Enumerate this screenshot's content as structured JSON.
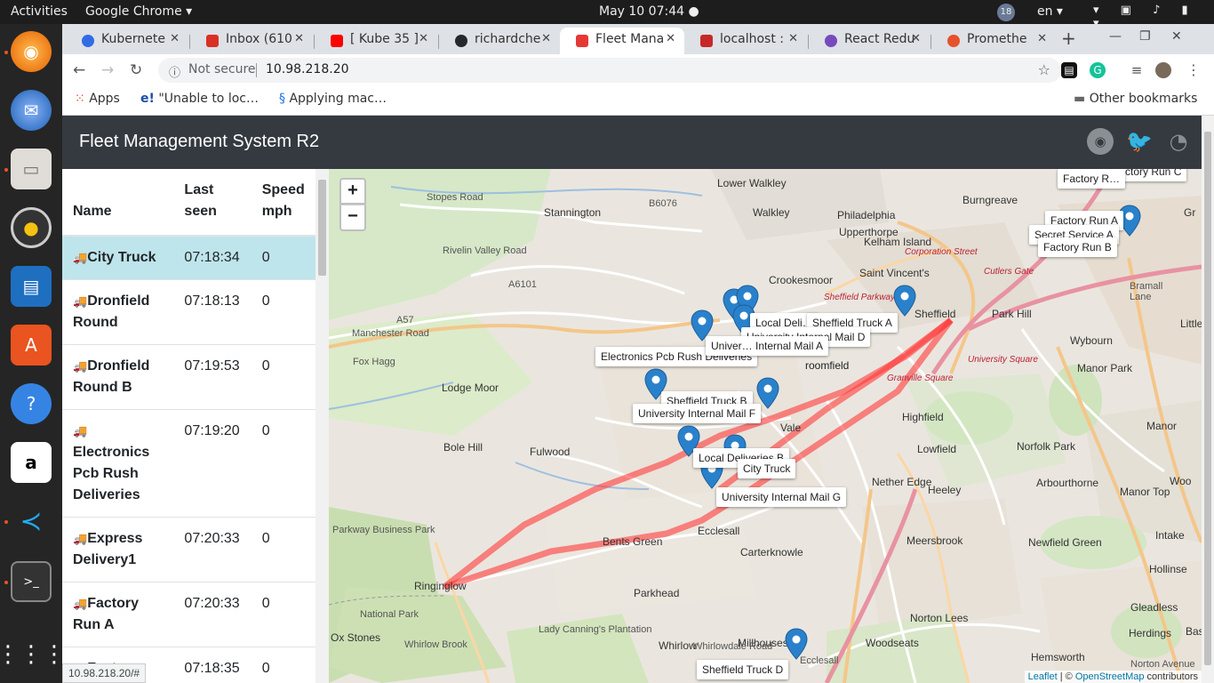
{
  "topbar": {
    "activities": "Activities",
    "app": "Google Chrome ▾",
    "clock": "May 10  07:44 ●",
    "badge": "18",
    "lang": "en ▾"
  },
  "dock": {
    "items": [
      "Firefox",
      "Thunderbird",
      "Files",
      "Rhythmbox",
      "LibreOffice Impress",
      "Ubuntu Software",
      "Help",
      "Amazon",
      "VS Code",
      "Terminal",
      "Show Applications"
    ]
  },
  "browser": {
    "tabs": [
      {
        "label": "Kubernete",
        "color": "#326ce5"
      },
      {
        "label": "Inbox (610",
        "color": "#d93025"
      },
      {
        "label": "[ Kube 35 ]",
        "color": "#ff0000"
      },
      {
        "label": "richardche",
        "color": "#24292e"
      },
      {
        "label": "Fleet Mana",
        "color": "#e53935"
      },
      {
        "label": "localhost :",
        "color": "#c62828"
      },
      {
        "label": "React Redu",
        "color": "#764abc"
      },
      {
        "label": "Promethe",
        "color": "#e6522c"
      }
    ],
    "address": {
      "security": "Not secure",
      "url": "10.98.218.20"
    },
    "bookmarks": {
      "apps": "Apps",
      "item1": "\"Unable to loc…",
      "item2": "Applying mac…",
      "other": "Other bookmarks"
    },
    "status_url": "10.98.218.20/#"
  },
  "app": {
    "title": "Fleet Management System R2",
    "table": {
      "headers": {
        "name": "Name",
        "last_seen": "Last seen",
        "speed": "Speed mph"
      },
      "rows": [
        {
          "name": "City Truck",
          "last_seen": "07:18:34",
          "speed": "0",
          "selected": true
        },
        {
          "name": "Dronfield Round",
          "last_seen": "07:18:13",
          "speed": "0"
        },
        {
          "name": "Dronfield Round B",
          "last_seen": "07:19:53",
          "speed": "0"
        },
        {
          "name": "Electronics Pcb Rush Deliveries",
          "last_seen": "07:19:20",
          "speed": "0"
        },
        {
          "name": "Express Delivery1",
          "last_seen": "07:20:33",
          "speed": "0"
        },
        {
          "name": "Factory Run A",
          "last_seen": "07:20:33",
          "speed": "0"
        },
        {
          "name": "Factory",
          "last_seen": "07:18:35",
          "speed": "0"
        }
      ]
    },
    "map": {
      "zoom_in": "+",
      "zoom_out": "−",
      "places": [
        "Lower Walkley",
        "Walkley",
        "Burngreave",
        "Stannington",
        "Philadelphia",
        "Upperthorpe",
        "Kelham Island",
        "Crookesmoor",
        "Saint Vincent's",
        "Sheffield",
        "Park Hill",
        "Wybourn",
        "Lodge Moor",
        "Manor Park",
        "Highfield",
        "Fulwood",
        "Vale",
        "Lowfield",
        "Norfolk Park",
        "Manor",
        "Bole Hill",
        "Nether Edge",
        "Arbourthorne",
        "Heeley",
        "Manor Top",
        "Bents Green",
        "Ecclesall",
        "Meersbrook",
        "Newfield Green",
        "Intake",
        "Ringinglow",
        "Carterknowle",
        "Hollinse",
        "Parkhead",
        "Gleadless",
        "Norton Lees",
        "Herdings",
        "Millhouses",
        "Woodseats",
        "Whirlow",
        "Hemsworth",
        "Ox Stones",
        "Little",
        "Gr",
        "Bas",
        "Woo"
      ],
      "roads": [
        "Stopes Road",
        "B6076",
        "Rivelin Valley Road",
        "A6101",
        "A57",
        "Manchester Road",
        "Fox Hagg",
        "Corporation Street",
        "Cutlers Gate",
        "Sheffield Parkway",
        "University Square",
        "Granville Square",
        "Bramall Lane",
        "Parkway Business Park",
        "National Park",
        "Lady Canning's Plantation",
        "Whirlow Brook",
        "Whirlowdale Road",
        "Ecclesall",
        "Norton Avenue"
      ],
      "popups": [
        "Factory Run C",
        "Factory R…",
        "Factory Run A",
        "Secret Service A",
        "Factory Run B",
        "Local Deli…",
        "Sheffield Truck A",
        "University Internal Mail D",
        "Electronics Pcb Rush Deliveries",
        "Univer… Internal Mail A",
        "Sheffield Truck B",
        "University Internal Mail F",
        "Local Deliveries B",
        "City Truck",
        "University Internal Mail G",
        "Sheffield Truck D",
        "roomfield"
      ],
      "attribution": {
        "leaflet": "Leaflet",
        "sep": " | © ",
        "osm": "OpenStreetMap",
        "contrib": " contributors"
      },
      "route_color": "#ff3b3b",
      "marker_color": "#2a81cb"
    }
  }
}
